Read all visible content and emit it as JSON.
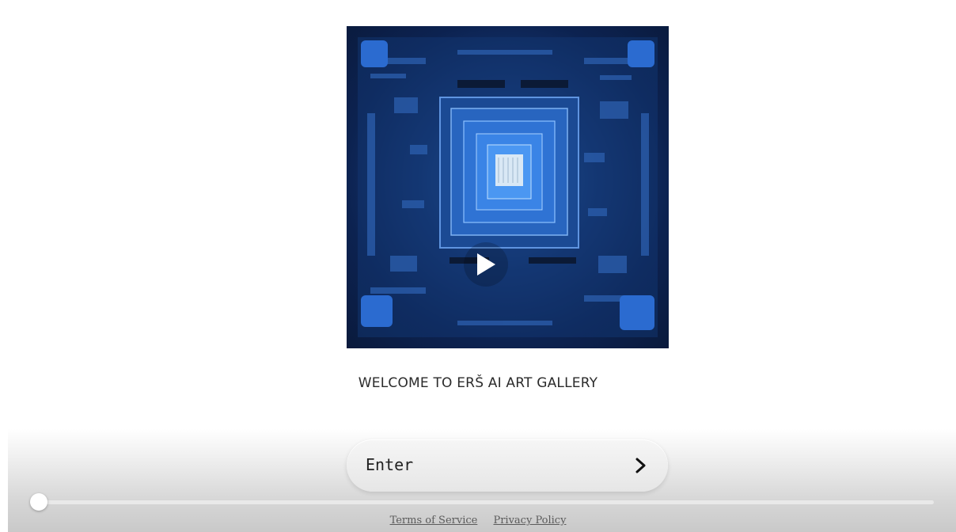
{
  "hero": {
    "image": "circuit-board-chip-artwork",
    "play_icon": "play-icon"
  },
  "welcome_text": "WELCOME TO ERŠ AI ART GALLERY",
  "enter_button": {
    "label": "Enter",
    "icon": "chevron-right-icon"
  },
  "progress": {
    "value": 0
  },
  "footer": {
    "terms": "Terms of Service",
    "privacy": "Privacy Policy"
  },
  "colors": {
    "accent_blue": "#1f4f9e",
    "text": "#2b2b2b"
  }
}
